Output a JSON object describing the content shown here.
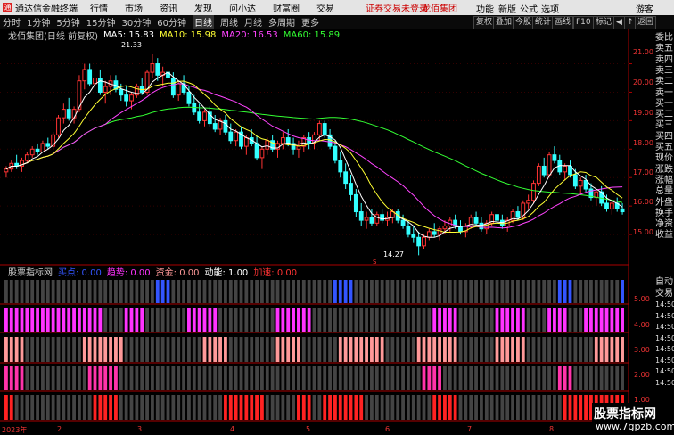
{
  "titlebar": {
    "app_name": "通达信金融终端",
    "menus": [
      "行情",
      "市场",
      "资讯",
      "发现",
      "问小达",
      "财富圈",
      "交易"
    ],
    "alert": "证券交易未登录",
    "stock": "龙佰集团",
    "right_menus": [
      "功能",
      "新版",
      "公式",
      "选项"
    ],
    "guest": "游客"
  },
  "toolbar": {
    "periods": [
      "分时",
      "1分钟",
      "5分钟",
      "15分钟",
      "30分钟",
      "60分钟",
      "日线",
      "周线",
      "月线",
      "多周期",
      "更多"
    ],
    "active": "日线",
    "right_buttons": [
      "复权",
      "叠加",
      "今股",
      "统计",
      "画线",
      "F10",
      "标记",
      "◀",
      "↑",
      "返回"
    ]
  },
  "chart_header": {
    "title": "龙佰集团(日线 前复权)",
    "ma5": "MA5: 15.83",
    "ma10": "MA10: 15.98",
    "ma20": "MA20: 16.53",
    "ma60": "MA60: 15.89",
    "colors": {
      "ma5": "#ffffff",
      "ma10": "#ffff33",
      "ma20": "#ff44ff",
      "ma60": "#33ff33"
    }
  },
  "annotations": {
    "high": "21.33",
    "low": "14.27",
    "low_mark": "S"
  },
  "side_panel": {
    "top": [
      "委比",
      "卖五",
      "卖四",
      "卖三",
      "卖二",
      "卖一",
      "买一",
      "买二",
      "买三",
      "买四",
      "买五",
      "现价",
      "涨跌",
      "涨幅",
      "总量",
      "外盘",
      "换手",
      "净资",
      "收益"
    ],
    "bottom": [
      "自动",
      "交易",
      "14:50",
      "14:50",
      "14:50",
      "14:50",
      "14:50",
      "14:50",
      "14:50",
      "14:50"
    ]
  },
  "indicator_header": {
    "name": "股票指标网",
    "items": [
      {
        "label": "买点: 0.00",
        "color": "#3355ff"
      },
      {
        "label": "趋势: 0.00",
        "color": "#ff33ff"
      },
      {
        "label": "资金: 0.00",
        "color": "#ff9999"
      },
      {
        "label": "动能: 1.00",
        "color": "#ffffff"
      },
      {
        "label": "加速: 0.00",
        "color": "#ff3333"
      }
    ]
  },
  "x_axis": [
    "2023年",
    "2",
    "3",
    "4",
    "5",
    "6",
    "7",
    "8"
  ],
  "price_axis": [
    "21.00",
    "20.00",
    "19.00",
    "18.00",
    "17.00",
    "16.00",
    "15.00"
  ],
  "ind_axis": [
    "5.00",
    "4.00",
    "3.00",
    "2.00",
    "1.00"
  ],
  "brand": {
    "name": "股票指标网",
    "url": "www.7gpzb.com"
  },
  "chart_data": {
    "type": "candlestick",
    "y_range": [
      14.0,
      21.8
    ],
    "candles_approx": [
      [
        17.2,
        17.4,
        17.0,
        17.3
      ],
      [
        17.3,
        17.6,
        17.2,
        17.5
      ],
      [
        17.5,
        17.8,
        17.3,
        17.4
      ],
      [
        17.4,
        17.7,
        17.2,
        17.6
      ],
      [
        17.6,
        17.9,
        17.5,
        17.8
      ],
      [
        17.8,
        18.1,
        17.7,
        18.0
      ],
      [
        18.0,
        18.2,
        17.8,
        17.9
      ],
      [
        17.9,
        18.3,
        17.9,
        18.2
      ],
      [
        18.2,
        18.4,
        18.0,
        18.1
      ],
      [
        18.1,
        18.6,
        18.0,
        18.5
      ],
      [
        18.5,
        19.2,
        18.4,
        19.1
      ],
      [
        19.1,
        19.6,
        18.9,
        19.4
      ],
      [
        19.4,
        19.8,
        19.0,
        19.1
      ],
      [
        19.1,
        19.5,
        18.9,
        19.4
      ],
      [
        19.4,
        20.6,
        19.3,
        20.4
      ],
      [
        20.4,
        21.0,
        20.1,
        20.8
      ],
      [
        20.8,
        21.0,
        20.2,
        20.3
      ],
      [
        20.3,
        20.7,
        20.0,
        20.5
      ],
      [
        20.5,
        20.8,
        19.9,
        20.0
      ],
      [
        20.0,
        20.4,
        19.6,
        20.2
      ],
      [
        20.2,
        20.6,
        19.9,
        20.4
      ],
      [
        20.4,
        20.6,
        20.0,
        20.1
      ],
      [
        20.1,
        20.3,
        19.7,
        19.9
      ],
      [
        19.9,
        20.2,
        19.5,
        19.7
      ],
      [
        19.7,
        20.0,
        19.4,
        19.9
      ],
      [
        19.9,
        20.3,
        19.8,
        20.2
      ],
      [
        20.2,
        20.5,
        19.9,
        20.0
      ],
      [
        20.0,
        20.8,
        19.9,
        20.7
      ],
      [
        20.7,
        21.33,
        20.5,
        21.0
      ],
      [
        21.0,
        21.2,
        20.4,
        20.6
      ],
      [
        20.6,
        20.9,
        20.2,
        20.7
      ],
      [
        20.7,
        21.0,
        20.4,
        20.5
      ],
      [
        20.5,
        20.7,
        19.8,
        19.9
      ],
      [
        19.9,
        20.4,
        19.7,
        20.3
      ],
      [
        20.3,
        20.6,
        19.9,
        20.0
      ],
      [
        20.0,
        20.2,
        19.5,
        19.6
      ],
      [
        19.6,
        19.9,
        19.2,
        19.3
      ],
      [
        19.3,
        19.6,
        18.9,
        19.0
      ],
      [
        19.0,
        19.4,
        18.8,
        19.3
      ],
      [
        19.3,
        19.5,
        18.8,
        18.9
      ],
      [
        18.9,
        19.2,
        18.6,
        18.7
      ],
      [
        18.7,
        19.1,
        18.5,
        19.0
      ],
      [
        19.0,
        19.2,
        18.5,
        18.6
      ],
      [
        18.6,
        18.9,
        18.2,
        18.3
      ],
      [
        18.3,
        18.7,
        18.1,
        18.6
      ],
      [
        18.6,
        18.8,
        18.0,
        18.1
      ],
      [
        18.1,
        18.5,
        17.8,
        18.4
      ],
      [
        18.4,
        18.7,
        18.1,
        18.2
      ],
      [
        18.2,
        18.5,
        17.6,
        17.7
      ],
      [
        17.7,
        18.1,
        17.3,
        18.0
      ],
      [
        18.0,
        18.4,
        17.8,
        18.3
      ],
      [
        18.3,
        18.5,
        17.9,
        18.0
      ],
      [
        18.0,
        18.3,
        17.7,
        18.2
      ],
      [
        18.2,
        18.6,
        18.0,
        18.4
      ],
      [
        18.4,
        18.7,
        18.1,
        18.2
      ],
      [
        18.2,
        18.4,
        17.8,
        18.0
      ],
      [
        18.0,
        18.3,
        17.7,
        18.1
      ],
      [
        18.1,
        18.5,
        17.9,
        18.4
      ],
      [
        18.4,
        18.6,
        18.0,
        18.2
      ],
      [
        18.2,
        18.6,
        18.0,
        18.5
      ],
      [
        18.5,
        19.0,
        18.3,
        18.9
      ],
      [
        18.9,
        19.0,
        18.4,
        18.5
      ],
      [
        18.5,
        18.7,
        18.0,
        18.1
      ],
      [
        18.1,
        18.3,
        17.5,
        17.6
      ],
      [
        17.6,
        17.9,
        17.0,
        17.2
      ],
      [
        17.2,
        17.5,
        16.6,
        16.8
      ],
      [
        16.8,
        17.1,
        16.2,
        16.4
      ],
      [
        16.4,
        16.6,
        15.6,
        15.8
      ],
      [
        15.8,
        16.1,
        15.3,
        15.5
      ],
      [
        15.5,
        15.8,
        15.2,
        15.6
      ],
      [
        15.6,
        15.9,
        15.3,
        15.4
      ],
      [
        15.4,
        15.8,
        15.3,
        15.7
      ],
      [
        15.7,
        15.9,
        15.4,
        15.5
      ],
      [
        15.5,
        15.8,
        15.3,
        15.6
      ],
      [
        15.6,
        15.9,
        15.4,
        15.8
      ],
      [
        15.8,
        15.9,
        15.4,
        15.5
      ],
      [
        15.5,
        15.7,
        15.2,
        15.3
      ],
      [
        15.3,
        15.5,
        14.9,
        15.0
      ],
      [
        15.0,
        15.3,
        14.7,
        14.9
      ],
      [
        14.9,
        15.1,
        14.27,
        14.6
      ],
      [
        14.6,
        15.0,
        14.5,
        14.9
      ],
      [
        14.9,
        15.2,
        14.8,
        15.1
      ],
      [
        15.1,
        15.4,
        14.9,
        15.0
      ],
      [
        15.0,
        15.3,
        14.8,
        15.2
      ],
      [
        15.2,
        15.5,
        15.0,
        15.3
      ],
      [
        15.3,
        15.6,
        15.1,
        15.5
      ],
      [
        15.5,
        15.7,
        15.2,
        15.3
      ],
      [
        15.3,
        15.5,
        15.0,
        15.1
      ],
      [
        15.1,
        15.4,
        14.9,
        15.3
      ],
      [
        15.3,
        15.7,
        15.2,
        15.6
      ],
      [
        15.6,
        15.8,
        15.3,
        15.4
      ],
      [
        15.4,
        15.6,
        15.1,
        15.2
      ],
      [
        15.2,
        15.5,
        15.0,
        15.4
      ],
      [
        15.4,
        15.8,
        15.3,
        15.7
      ],
      [
        15.7,
        15.9,
        15.4,
        15.5
      ],
      [
        15.5,
        15.7,
        15.2,
        15.3
      ],
      [
        15.3,
        15.6,
        15.1,
        15.5
      ],
      [
        15.5,
        15.9,
        15.4,
        15.8
      ],
      [
        15.8,
        16.0,
        15.5,
        15.6
      ],
      [
        15.6,
        16.2,
        15.5,
        16.1
      ],
      [
        16.1,
        16.4,
        15.9,
        16.2
      ],
      [
        16.2,
        16.9,
        16.1,
        16.8
      ],
      [
        16.8,
        17.5,
        16.7,
        17.4
      ],
      [
        17.4,
        17.7,
        17.0,
        17.1
      ],
      [
        17.1,
        17.9,
        17.0,
        17.8
      ],
      [
        17.8,
        18.1,
        17.5,
        17.6
      ],
      [
        17.6,
        17.8,
        17.1,
        17.2
      ],
      [
        17.2,
        17.5,
        16.9,
        17.4
      ],
      [
        17.4,
        17.6,
        17.0,
        17.1
      ],
      [
        17.1,
        17.3,
        16.6,
        16.7
      ],
      [
        16.7,
        17.0,
        16.4,
        16.9
      ],
      [
        16.9,
        17.1,
        16.5,
        16.6
      ],
      [
        16.6,
        16.8,
        16.2,
        16.3
      ],
      [
        16.3,
        16.6,
        16.0,
        16.5
      ],
      [
        16.5,
        16.7,
        16.0,
        16.1
      ],
      [
        16.1,
        16.4,
        15.8,
        15.9
      ],
      [
        15.9,
        16.2,
        15.7,
        16.1
      ],
      [
        16.1,
        16.3,
        15.8,
        15.9
      ],
      [
        15.9,
        16.1,
        15.7,
        15.8
      ]
    ]
  }
}
